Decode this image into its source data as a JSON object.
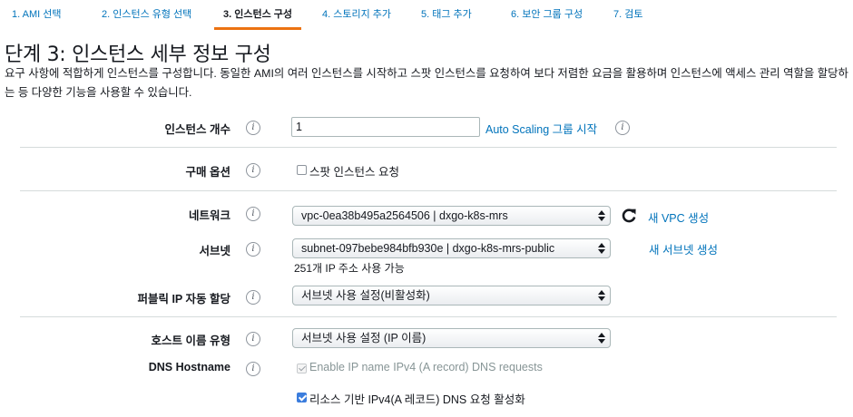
{
  "tabs": [
    {
      "label": "1. AMI 선택",
      "active": false
    },
    {
      "label": "2. 인스턴스 유형 선택",
      "active": false
    },
    {
      "label": "3. 인스턴스 구성",
      "active": true
    },
    {
      "label": "4. 스토리지 추가",
      "active": false
    },
    {
      "label": "5. 태그 추가",
      "active": false
    },
    {
      "label": "6. 보안 그룹 구성",
      "active": false
    },
    {
      "label": "7. 검토",
      "active": false
    }
  ],
  "page": {
    "title": "단계 3: 인스턴스 세부 정보 구성",
    "description": "요구 사항에 적합하게 인스턴스를 구성합니다. 동일한 AMI의 여러 인스턴스를 시작하고 스팟 인스턴스를 요청하여 보다 저렴한 요금을 활용하며 인스턴스에 액세스 관리 역할을 할당하는 등 다양한 기능을 사용할 수 있습니다."
  },
  "form": {
    "instance_count": {
      "label": "인스턴스 개수",
      "value": "1",
      "link": "Auto Scaling 그룹 시작"
    },
    "purchase_option": {
      "label": "구매 옵션",
      "checkbox_label": "스팟 인스턴스 요청",
      "checked": false
    },
    "network": {
      "label": "네트워크",
      "value": "vpc-0ea38b495a2564506 | dxgo-k8s-mrs",
      "link": "새 VPC 생성"
    },
    "subnet": {
      "label": "서브넷",
      "value": "subnet-097bebe984bfb930e | dxgo-k8s-mrs-public",
      "link": "새 서브넷 생성",
      "hint": "251개 IP 주소 사용 가능"
    },
    "public_ip": {
      "label": "퍼블릭 IP 자동 할당",
      "value": "서브넷 사용 설정(비활성화)"
    },
    "hostname_type": {
      "label": "호스트 이름 유형",
      "value": "서브넷 사용 설정 (IP 이름)"
    },
    "dns_hostname": {
      "label": "DNS Hostname",
      "option1": {
        "label": "Enable IP name IPv4 (A record) DNS requests",
        "checked": true,
        "disabled": true
      },
      "option2": {
        "label": "리소스 기반 IPv4(A 레코드) DNS 요청 활성화",
        "checked": true,
        "disabled": false
      }
    }
  },
  "icons": {
    "info": "i",
    "refresh": "refresh-icon"
  },
  "colors": {
    "link": "#0073bb",
    "active_tab_underline": "#ec7211",
    "checkbox": "#3b7ddd"
  }
}
